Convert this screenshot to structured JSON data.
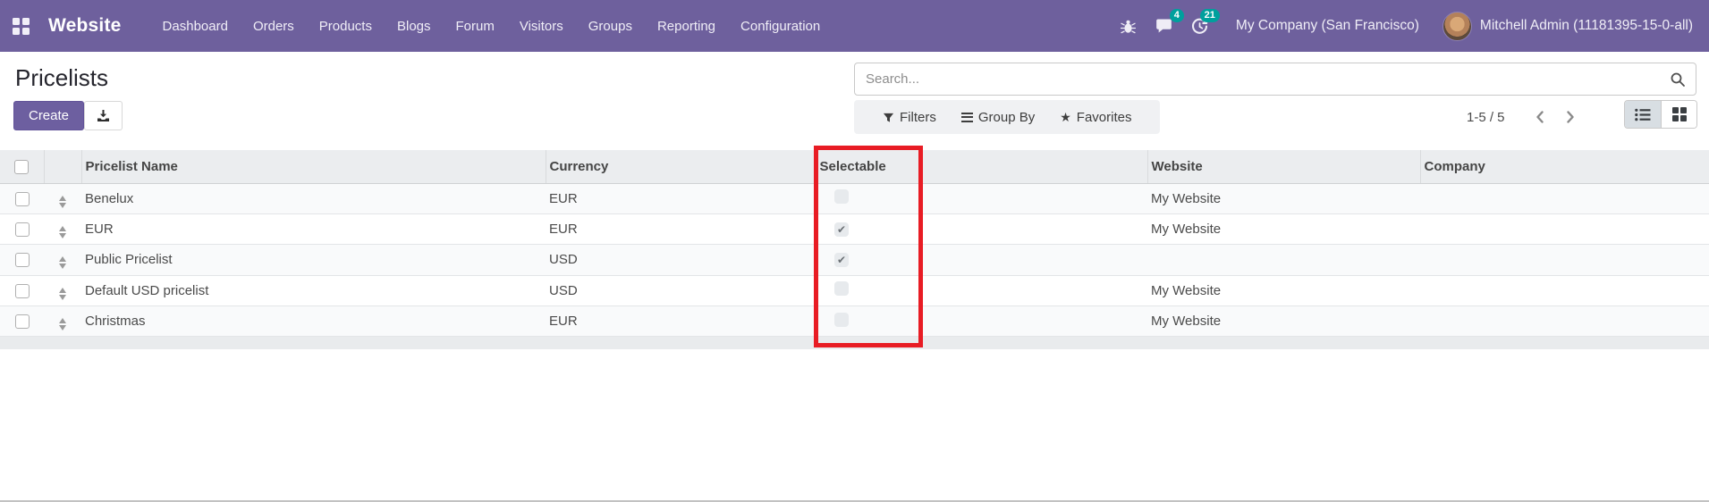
{
  "navbar": {
    "brand": "Website",
    "menu": [
      "Dashboard",
      "Orders",
      "Products",
      "Blogs",
      "Forum",
      "Visitors",
      "Groups",
      "Reporting",
      "Configuration"
    ],
    "message_count": "4",
    "activity_count": "21",
    "company": "My Company (San Francisco)",
    "user": "Mitchell Admin (11181395-15-0-all)",
    "colors": {
      "background": "#6e609d",
      "badge": "#00a09d"
    }
  },
  "page": {
    "title": "Pricelists",
    "create_label": "Create",
    "search_placeholder": "Search...",
    "filters_label": "Filters",
    "group_by_label": "Group By",
    "favorites_label": "Favorites",
    "pager_text": "1-5 / 5"
  },
  "table": {
    "headers": [
      "Pricelist Name",
      "Currency",
      "Selectable",
      "Website",
      "Company"
    ],
    "rows": [
      {
        "name": "Benelux",
        "currency": "EUR",
        "selectable": false,
        "website": "My Website",
        "company": ""
      },
      {
        "name": "EUR",
        "currency": "EUR",
        "selectable": true,
        "website": "My Website",
        "company": ""
      },
      {
        "name": "Public Pricelist",
        "currency": "USD",
        "selectable": true,
        "website": "",
        "company": ""
      },
      {
        "name": "Default USD pricelist",
        "currency": "USD",
        "selectable": false,
        "website": "My Website",
        "company": ""
      },
      {
        "name": "Christmas",
        "currency": "EUR",
        "selectable": false,
        "website": "My Website",
        "company": ""
      }
    ]
  },
  "annotation": {
    "type": "highlight-box",
    "target": "Selectable column",
    "color": "#e81c24"
  }
}
